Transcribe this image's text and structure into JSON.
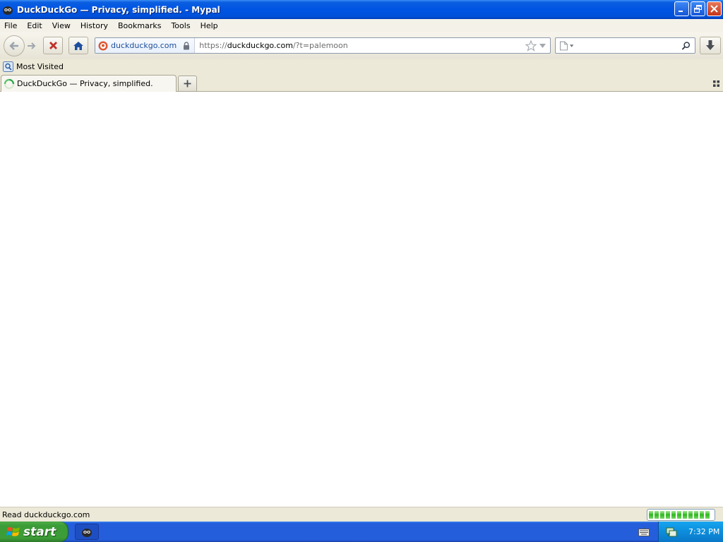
{
  "window": {
    "title": "DuckDuckGo — Privacy, simplified. - Mypal"
  },
  "menu": [
    "File",
    "Edit",
    "View",
    "History",
    "Bookmarks",
    "Tools",
    "Help"
  ],
  "toolbar": {
    "identity_label": "duckduckgo.com",
    "url_prefix": "https://",
    "url_host": "duckduckgo.com",
    "url_path": "/?t=palemoon",
    "search_value": ""
  },
  "bookmarks": [
    {
      "label": "Most Visited",
      "icon": "most-visited-icon"
    }
  ],
  "tabs": [
    {
      "label": "DuckDuckGo — Privacy, simplified.",
      "icon": "loading-throbber-icon"
    }
  ],
  "status": {
    "text": "Read duckduckgo.com",
    "progress_percent": 100
  },
  "taskbar": {
    "start_label": "start",
    "clock": "7:32 PM"
  },
  "colors": {
    "titlebar": "#0054E3",
    "taskbar": "#245EDB",
    "start": "#3C9C37",
    "tray": "#0C8DDB"
  }
}
